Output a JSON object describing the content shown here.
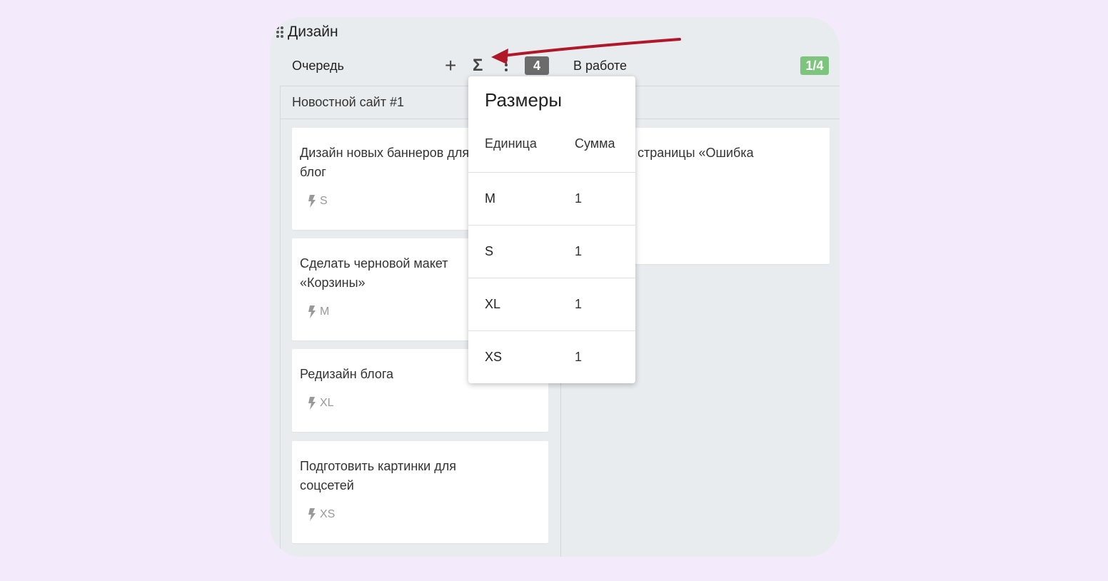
{
  "board": {
    "title": "Дизайн"
  },
  "columns": {
    "queue": {
      "name": "Очередь",
      "plus_icon": "+",
      "sigma_icon": "Σ",
      "count": "4"
    },
    "work": {
      "name": "В работе",
      "wip": "1/4"
    }
  },
  "swimlane": {
    "title": "Новостной сайт #1"
  },
  "cards": [
    {
      "title": "Дизайн новых баннеров для блог",
      "size": "S"
    },
    {
      "title": "Сделать черновой макет «Корзины»",
      "size": "M"
    },
    {
      "title": "Редизайн блога",
      "size": "XL"
    },
    {
      "title": "Подготовить картинки для соцсетей",
      "size": "XS"
    }
  ],
  "work_card": {
    "title": "страницы «Ошибка"
  },
  "popup": {
    "title": "Размеры",
    "col_unit": "Единица",
    "col_sum": "Сумма",
    "rows": [
      {
        "unit": "M",
        "sum": "1"
      },
      {
        "unit": "S",
        "sum": "1"
      },
      {
        "unit": "XL",
        "sum": "1"
      },
      {
        "unit": "XS",
        "sum": "1"
      }
    ]
  },
  "colors": {
    "page_background": "#f3eafb",
    "board_background": "#e8ecef",
    "count_badge": "#6b6b6b",
    "wip_badge": "#7dc47d",
    "annotation_arrow": "#b0182a"
  },
  "icons": [
    "drag-handle-icon",
    "plus-icon",
    "sigma-icon",
    "kebab-menu-icon",
    "lightning-icon"
  ]
}
